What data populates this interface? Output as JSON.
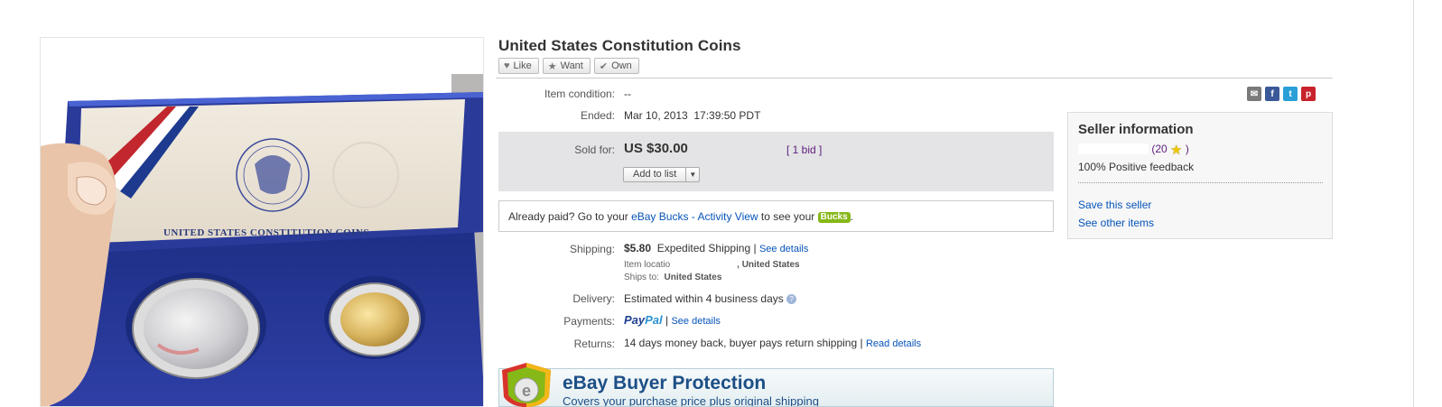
{
  "listing": {
    "title": "United States Constitution Coins",
    "image_caption": "UNITED STATES CONSTITUTION COINS",
    "actions": {
      "like": "Like",
      "want": "Want",
      "own": "Own"
    }
  },
  "details": {
    "condition_label": "Item condition:",
    "condition_value": "--",
    "ended_label": "Ended:",
    "ended_value": "Mar 10, 2013  17:39:50 PDT",
    "sold_label": "Sold for:",
    "sold_price": "US $30.00",
    "bids": "[ 1 bid ]",
    "add_to_list": "Add to list",
    "bucks_prefix": "Already paid? Go to your ",
    "bucks_link": "eBay Bucks - Activity View",
    "bucks_suffix": " to see your ",
    "bucks_badge": "Bucks",
    "bucks_end": ".",
    "shipping_label": "Shipping:",
    "shipping_cost": "$5.80",
    "shipping_method": "Expedited Shipping",
    "shipping_sep": "|",
    "see_details": "See details",
    "item_location_prefix": "Item locatio",
    "item_location_country": ", United States",
    "ships_to_label": "Ships to:",
    "ships_to_value": "United States",
    "delivery_label": "Delivery:",
    "delivery_value": "Estimated within 4 business days",
    "delivery_help": "?",
    "payments_label": "Payments:",
    "paypal_1": "Pay",
    "paypal_2": "Pal",
    "payments_sep": "|",
    "payments_link": "See details",
    "returns_label": "Returns:",
    "returns_value": "14 days money back, buyer pays return shipping",
    "returns_sep": "|",
    "returns_link": "Read details"
  },
  "protection": {
    "title": "eBay Buyer Protection",
    "subtitle": "Covers your purchase price plus original shipping"
  },
  "share_icons": [
    "email-icon",
    "facebook-icon",
    "twitter-icon",
    "pinterest-icon"
  ],
  "seller": {
    "heading": "Seller information",
    "score_open": "(20",
    "score_close": ")",
    "feedback": "100% Positive feedback",
    "save": "Save this seller",
    "other": "See other items"
  },
  "colors": {
    "link": "#0654ba",
    "bids": "#5d1d7b",
    "sold_bg": "#e4e4e6",
    "bucks_badge": "#86b817",
    "facebook": "#3b5998",
    "twitter": "#2a9fd8",
    "pinterest": "#c8232c"
  }
}
